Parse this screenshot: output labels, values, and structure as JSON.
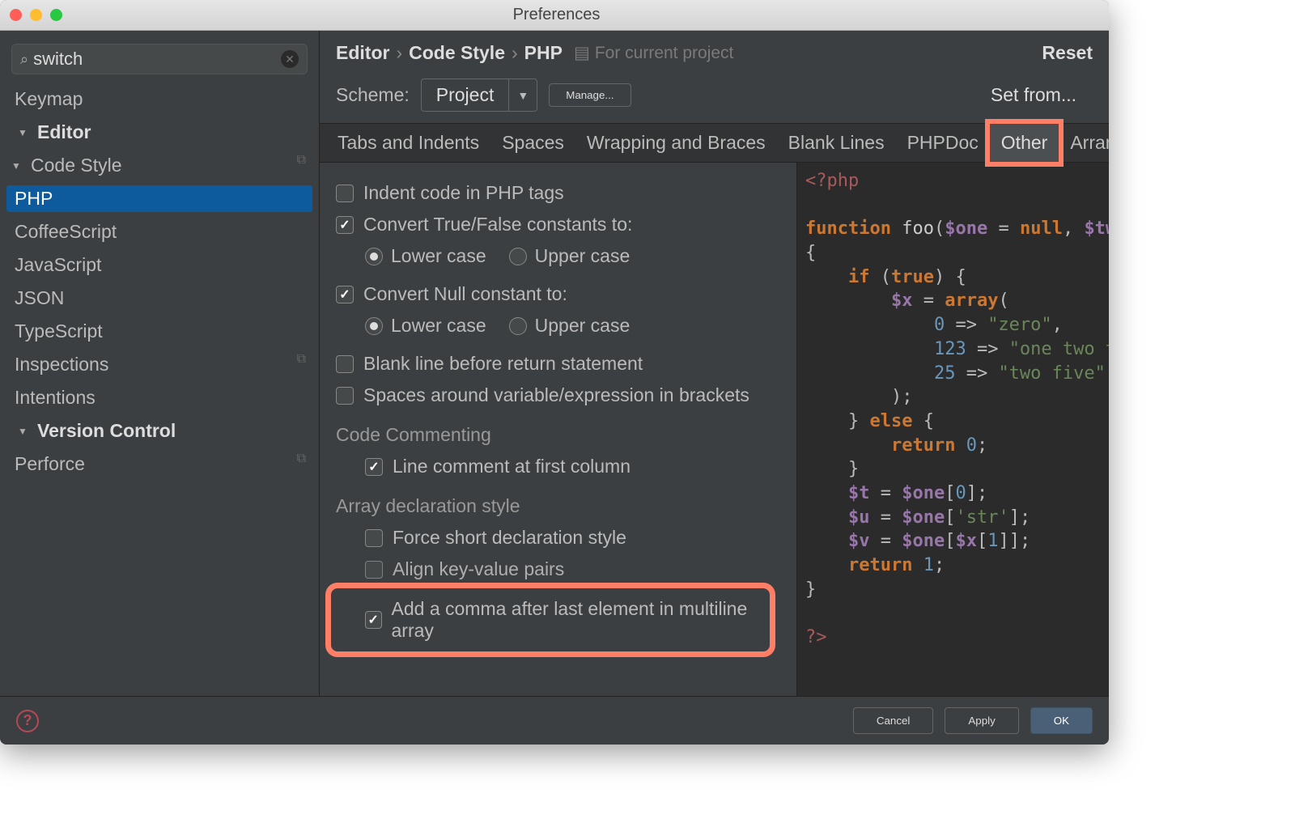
{
  "window": {
    "title": "Preferences"
  },
  "search": {
    "value": "switch"
  },
  "tree": {
    "keymap": "Keymap",
    "editor": "Editor",
    "codestyle": "Code Style",
    "items": [
      "PHP",
      "CoffeeScript",
      "JavaScript",
      "JSON",
      "TypeScript"
    ],
    "inspections": "Inspections",
    "intentions": "Intentions",
    "vc": "Version Control",
    "perforce": "Perforce"
  },
  "breadcrumb": {
    "a": "Editor",
    "b": "Code Style",
    "c": "PHP",
    "note": "For current project",
    "reset": "Reset"
  },
  "scheme": {
    "label": "Scheme:",
    "value": "Project",
    "manage": "Manage...",
    "setfrom": "Set from..."
  },
  "tabs": [
    "Tabs and Indents",
    "Spaces",
    "Wrapping and Braces",
    "Blank Lines",
    "PHPDoc",
    "Other",
    "Arrangement"
  ],
  "opts": {
    "indent_php": "Indent code in PHP tags",
    "convert_tf": "Convert True/False constants to:",
    "lower": "Lower case",
    "upper": "Upper case",
    "convert_null": "Convert Null constant to:",
    "blank_return": "Blank line before return statement",
    "spaces_brackets": "Spaces around variable/expression in brackets",
    "code_commenting_h": "Code Commenting",
    "line_comment": "Line comment at first column",
    "array_h": "Array declaration style",
    "force_short": "Force short declaration style",
    "align_kv": "Align key-value pairs",
    "trailing_comma": "Add a comma after last element in multiline array"
  },
  "code": {
    "open": "<?php",
    "l1a": "function",
    "l1b": "foo",
    "l1c": "$one",
    "l1d": "null",
    "l1e": "$two",
    "l3a": "if",
    "l3b": "true",
    "l4a": "$x",
    "l4b": "array",
    "l5k": "0",
    "l5v": "\"zero\"",
    "l6k": "123",
    "l6v": "\"one two three\"",
    "l7k": "25",
    "l7v": "\"two five\"",
    "l9a": "else",
    "l10a": "return",
    "l10b": "0",
    "l12a": "$t",
    "l12b": "$one",
    "l12c": "0",
    "l13a": "$u",
    "l13b": "$one",
    "l13c": "'str'",
    "l14a": "$v",
    "l14b": "$one",
    "l14c": "$x",
    "l14d": "1",
    "l15a": "return",
    "l15b": "1",
    "close": "?>"
  },
  "footer": {
    "cancel": "Cancel",
    "apply": "Apply",
    "ok": "OK"
  }
}
